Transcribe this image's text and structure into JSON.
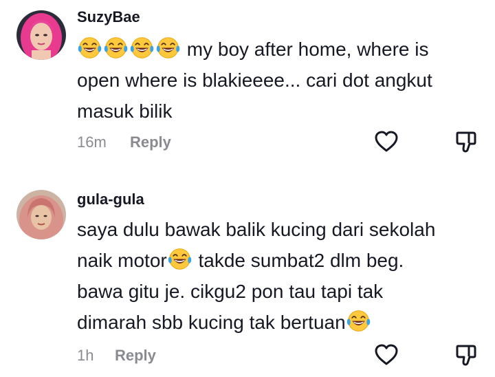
{
  "comments": [
    {
      "username": "SuzyBae",
      "emoji": "😂",
      "text_line1": "my boy after home, where is",
      "text_line2": "open where is blakieeee... cari dot angkut",
      "text_line3": "masuk bilik",
      "time": "16m",
      "reply_label": "Reply"
    },
    {
      "username": "gula-gula",
      "emoji": "😂",
      "text_line1": "saya dulu bawak balik kucing dari sekolah",
      "text_line2a": "naik motor",
      "text_line2b": " takde sumbat2 dlm beg.",
      "text_line3": "bawa gitu je. cikgu2 pon tau tapi tak",
      "text_line4": "dimarah sbb kucing tak bertuan",
      "time": "1h",
      "reply_label": "Reply"
    }
  ],
  "icons": {
    "like": "heart-outline-icon",
    "dislike": "thumbs-down-outline-icon",
    "emoji": "face-with-tears-of-joy-icon"
  },
  "colors": {
    "text": "#161823",
    "meta": "#8a8b91",
    "emoji_face": "#ffc83d",
    "emoji_tears": "#3aa3e8"
  }
}
